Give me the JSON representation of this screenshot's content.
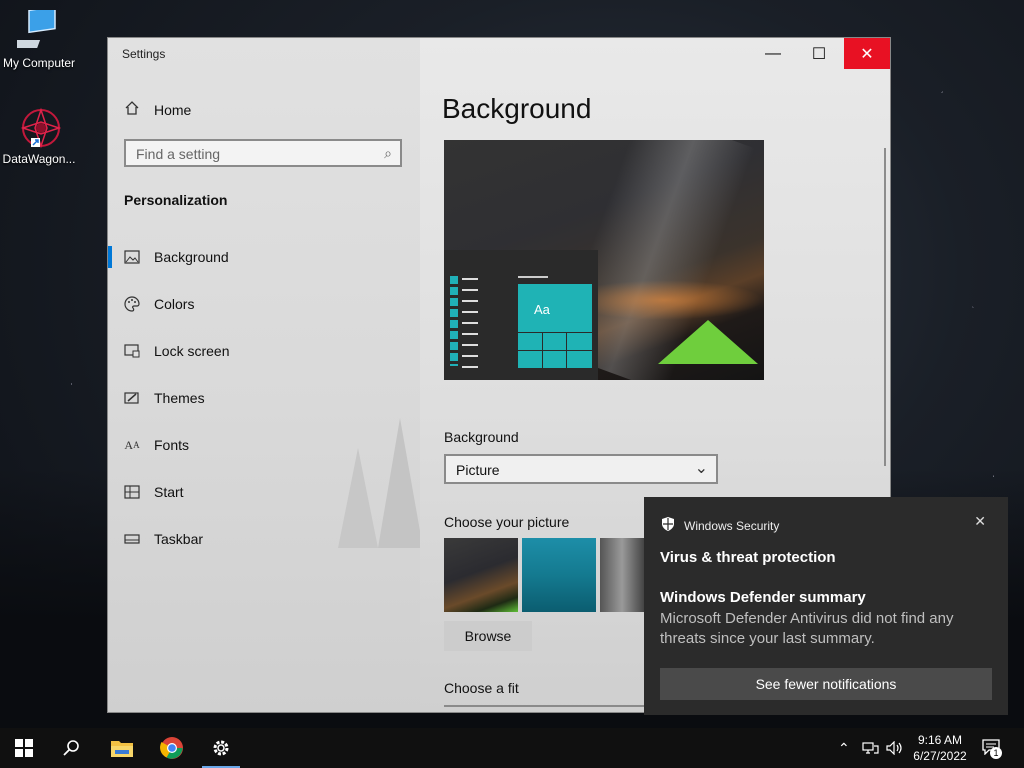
{
  "desktop": {
    "icons": [
      {
        "label": "My Computer"
      },
      {
        "label": "DataWagon..."
      }
    ]
  },
  "window": {
    "title": "Settings",
    "controls": {
      "minimize": "—",
      "maximize": "☐",
      "close": "✕"
    }
  },
  "sidebar": {
    "home_label": "Home",
    "search_placeholder": "Find a setting",
    "section_title": "Personalization",
    "items": [
      {
        "label": "Background",
        "icon": "picture-icon",
        "selected": true
      },
      {
        "label": "Colors",
        "icon": "palette-icon"
      },
      {
        "label": "Lock screen",
        "icon": "lock-screen-icon"
      },
      {
        "label": "Themes",
        "icon": "themes-icon"
      },
      {
        "label": "Fonts",
        "icon": "fonts-icon"
      },
      {
        "label": "Start",
        "icon": "start-icon"
      },
      {
        "label": "Taskbar",
        "icon": "taskbar-icon"
      }
    ],
    "accent_color": "#0078d7"
  },
  "main": {
    "page_title": "Background",
    "preview": {
      "tile_text": "Aa"
    },
    "background_label": "Background",
    "background_value": "Picture",
    "choose_picture_label": "Choose your picture",
    "browse_label": "Browse",
    "choose_fit_label": "Choose a fit"
  },
  "notification": {
    "app_name": "Windows Security",
    "title": "Virus & threat protection",
    "subtitle": "Windows Defender summary",
    "body": "Microsoft Defender Antivirus did not find any threats since your last summary.",
    "button_label": "See fewer notifications"
  },
  "taskbar": {
    "time": "9:16 AM",
    "date": "6/27/2022",
    "notification_count": "1"
  }
}
